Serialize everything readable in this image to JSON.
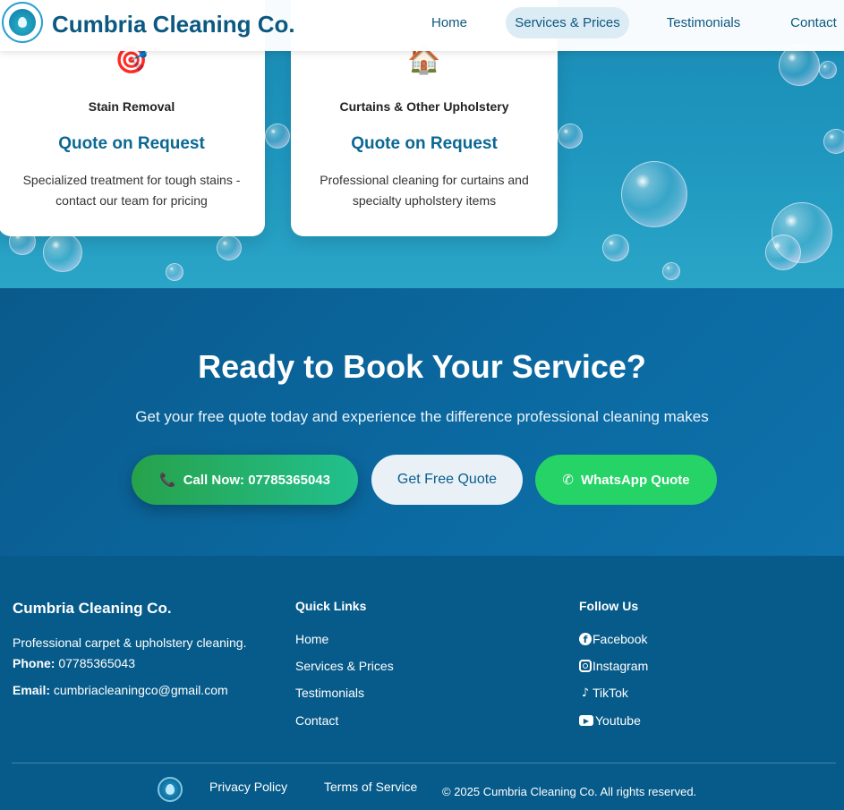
{
  "header": {
    "brand": "Cumbria Cleaning Co.",
    "nav": [
      {
        "label": "Home",
        "active": false
      },
      {
        "label": "Services & Prices",
        "active": true
      },
      {
        "label": "Testimonials",
        "active": false
      },
      {
        "label": "Contact",
        "active": false
      }
    ]
  },
  "services": {
    "cards": [
      {
        "icon": "target-icon",
        "emoji": "🎯",
        "title": "Stain Removal",
        "price": "Quote on Request",
        "description": "Specialized treatment for tough stains - contact our team for pricing"
      },
      {
        "icon": "house-icon",
        "emoji": "🏠",
        "title": "Curtains & Other Upholstery",
        "price": "Quote on Request",
        "description": "Professional cleaning for curtains and specialty upholstery items"
      }
    ]
  },
  "cta": {
    "heading": "Ready to Book Your Service?",
    "subheading": "Get your free quote today and experience the difference professional cleaning makes",
    "call_icon": "📞",
    "call_label": "Call Now: 07785365043",
    "quote_label": "Get Free Quote",
    "whatsapp_icon": "✆",
    "whatsapp_label": "WhatsApp Quote"
  },
  "footer": {
    "about": {
      "title": "Cumbria Cleaning Co.",
      "tagline": "Professional carpet & upholstery cleaning.",
      "phone_label": "Phone:",
      "phone": "07785365043",
      "email_label": "Email:",
      "email": "cumbriacleaningco@gmail.com"
    },
    "quick_links": {
      "title": "Quick Links",
      "items": [
        "Home",
        "Services & Prices",
        "Testimonials",
        "Contact"
      ]
    },
    "follow": {
      "title": "Follow Us",
      "items": [
        {
          "label": "Facebook",
          "icon": "facebook-icon",
          "glyph": "f"
        },
        {
          "label": "Instagram",
          "icon": "instagram-icon",
          "glyph": ""
        },
        {
          "label": "TikTok",
          "icon": "tiktok-icon",
          "glyph": "♪"
        },
        {
          "label": "Youtube",
          "icon": "youtube-icon",
          "glyph": "▶"
        }
      ]
    },
    "bottom": {
      "privacy": "Privacy Policy",
      "terms": "Terms of Service",
      "copyright": "© 2025 Cumbria Cleaning Co. All rights reserved."
    }
  },
  "colors": {
    "primary": "#0b5880",
    "footer_bg": "#075b8a",
    "cta_bg": "#0b6aa2",
    "whatsapp": "#25d366",
    "call_gradient_start": "#27a24b"
  }
}
